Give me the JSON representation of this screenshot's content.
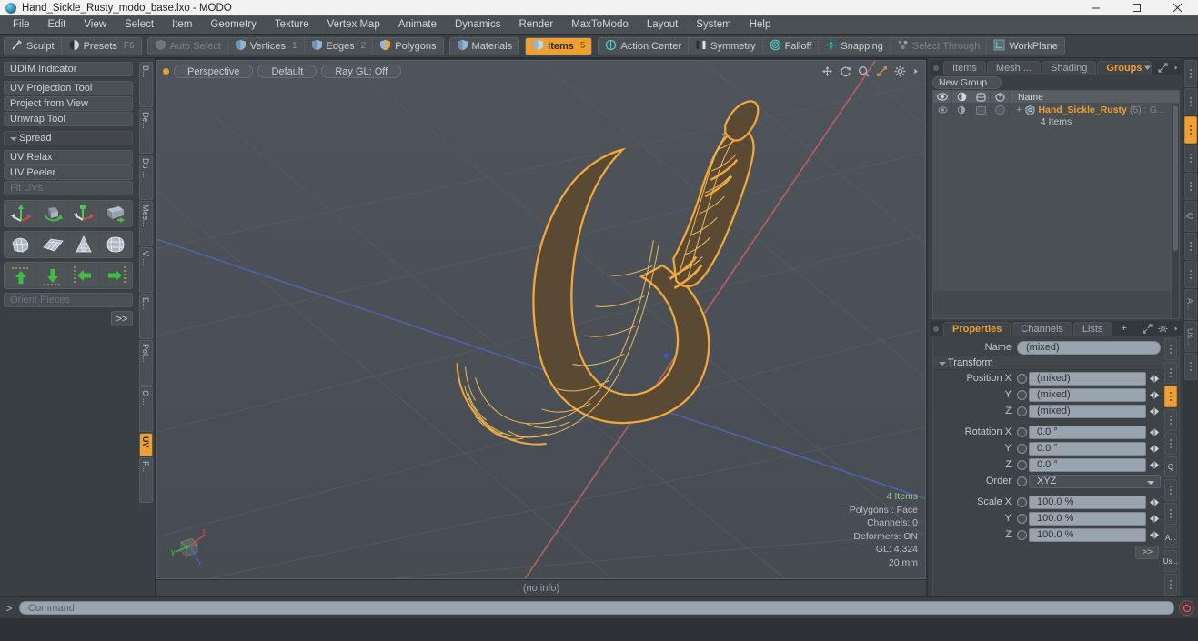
{
  "window": {
    "title": "Hand_Sickle_Rusty_modo_base.lxo - MODO",
    "app_icon": "modo-sphere-icon",
    "minimize": "—",
    "maximize": "☐",
    "close": "✕"
  },
  "menubar": {
    "items": [
      {
        "label": "File"
      },
      {
        "label": "Edit"
      },
      {
        "label": "View"
      },
      {
        "label": "Select"
      },
      {
        "label": "Item"
      },
      {
        "label": "Geometry"
      },
      {
        "label": "Texture"
      },
      {
        "label": "Vertex Map"
      },
      {
        "label": "Animate"
      },
      {
        "label": "Dynamics"
      },
      {
        "label": "Render"
      },
      {
        "label": "MaxToModo"
      },
      {
        "label": "Layout"
      },
      {
        "label": "System"
      },
      {
        "label": "Help"
      }
    ]
  },
  "toolbar": {
    "group1": [
      {
        "label": "Sculpt",
        "icon": "brush-icon",
        "num": "",
        "state": "normal"
      },
      {
        "label": "Presets",
        "icon": "sphere-icon",
        "num": "F6",
        "state": "normal"
      }
    ],
    "group2": [
      {
        "label": "Auto Select",
        "icon": "shield-grey-icon",
        "num": "",
        "state": "dim"
      },
      {
        "label": "Vertices",
        "icon": "shield-vertex-icon",
        "num": "1",
        "state": "normal"
      },
      {
        "label": "Edges",
        "icon": "shield-edge-icon",
        "num": "2",
        "state": "normal"
      },
      {
        "label": "Polygons",
        "icon": "shield-polygon-icon",
        "num": "",
        "state": "normal"
      }
    ],
    "group3": [
      {
        "label": "Materials",
        "icon": "shield-material-icon",
        "num": "",
        "state": "normal"
      }
    ],
    "group4": [
      {
        "label": "Items",
        "icon": "shield-items-icon",
        "num": "5",
        "state": "active"
      }
    ],
    "group5": [
      {
        "label": "Action Center",
        "icon": "target-icon",
        "num": "",
        "state": "normal"
      },
      {
        "label": "Symmetry",
        "icon": "symmetry-bars-icon",
        "num": "",
        "state": "normal"
      },
      {
        "label": "Falloff",
        "icon": "falloff-circle-icon",
        "num": "",
        "state": "normal"
      },
      {
        "label": "Snapping",
        "icon": "snap-cross-icon",
        "num": "",
        "state": "normal"
      },
      {
        "label": "Select Through",
        "icon": "select-through-icon",
        "num": "",
        "state": "dim"
      },
      {
        "label": "WorkPlane",
        "icon": "workplane-icon",
        "num": "",
        "state": "normal"
      }
    ]
  },
  "left_panel": {
    "rows_top": [
      {
        "label": "UDIM Indicator",
        "state": "normal"
      }
    ],
    "rows_mid": [
      {
        "label": "UV Projection Tool",
        "state": "normal"
      },
      {
        "label": "Project from View",
        "state": "normal"
      },
      {
        "label": "Unwrap Tool",
        "state": "normal"
      }
    ],
    "section_header": "Spread",
    "rows_bottom": [
      {
        "label": "UV Relax",
        "state": "normal"
      },
      {
        "label": "UV Peeler",
        "state": "normal"
      },
      {
        "label": "Fit UVs",
        "state": "dim"
      }
    ],
    "icon_grid_1": [
      "move-axis-icon",
      "rotate-cube-icon",
      "scale-axis-icon",
      "transform-box-icon"
    ],
    "icon_grid_2": [
      "shrink-mesh-icon",
      "grid-flat-icon",
      "cone-grid-icon",
      "sphere-grid-icon"
    ],
    "icon_grid_3": [
      "align-up-icon",
      "align-down-icon",
      "align-left-icon",
      "align-right-icon"
    ],
    "orient_field_placeholder": "Orient Pieces",
    "more_button": ">>",
    "vtabs": [
      {
        "label": "B...",
        "state": "normal"
      },
      {
        "label": "De...",
        "state": "normal"
      },
      {
        "label": "Du ...",
        "state": "normal"
      },
      {
        "label": "Mes...",
        "state": "normal"
      },
      {
        "label": "V ...",
        "state": "normal"
      },
      {
        "label": "E...",
        "state": "normal"
      },
      {
        "label": "Pol...",
        "state": "normal"
      },
      {
        "label": "C ...",
        "state": "normal"
      },
      {
        "label": "UV",
        "state": "active"
      },
      {
        "label": "F...",
        "state": "normal"
      }
    ]
  },
  "viewport": {
    "buttons": [
      {
        "label": "Perspective"
      },
      {
        "label": "Default"
      },
      {
        "label": "Ray GL: Off"
      }
    ],
    "tool_icons": [
      "pan-icon",
      "rotate-icon",
      "zoom-icon",
      "fit-icon",
      "gear-icon",
      "chevron-right-icon"
    ],
    "info": {
      "items": "4 Items",
      "polygons": "Polygons : Face",
      "channels": "Channels: 0",
      "deformers": "Deformers: ON",
      "gl": "GL: 4,324",
      "scale": "20 mm"
    },
    "axis_gizmo": [
      "x",
      "y",
      "z"
    ],
    "status": "(no info)",
    "model": "hand-sickle-rusty-wireframe",
    "colors": {
      "selection": "#f0a030",
      "background": "#4a5055",
      "axis_x": "#b55a5a",
      "axis_z": "#5a6fb5",
      "grid": "#565c62"
    }
  },
  "right_panel": {
    "tabs": [
      {
        "label": "Items",
        "state": "normal"
      },
      {
        "label": "Mesh ...",
        "state": "normal"
      },
      {
        "label": "Shading",
        "state": "normal"
      },
      {
        "label": "Groups",
        "state": "active"
      }
    ],
    "tab_icons": [
      "chevron-down-icon",
      "expand-icon",
      "chevron-right-icon"
    ],
    "new_group_button": "New Group",
    "list": {
      "col_icons": [
        "eye-icon",
        "render-icon",
        "wireframe-icon",
        "shaded-icon"
      ],
      "name_header": "Name",
      "rows": [
        {
          "icon": "group-shield-icon",
          "name": "Hand_Sickle_Rusty",
          "count": "(5)",
          "suffix": ": G...",
          "sub": "4 Items"
        }
      ]
    }
  },
  "properties": {
    "tabs": [
      {
        "label": "Properties",
        "state": "active"
      },
      {
        "label": "Channels",
        "state": "normal"
      },
      {
        "label": "Lists",
        "state": "normal"
      },
      {
        "label": "+",
        "state": "normal"
      }
    ],
    "tab_icons": [
      "expand-icon",
      "gear-icon",
      "chevron-right-icon"
    ],
    "name_label": "Name",
    "name_value": "(mixed)",
    "transform_header": "Transform",
    "fields": [
      {
        "label": "Position X",
        "value": "(mixed)",
        "type": "text"
      },
      {
        "label": "Y",
        "value": "(mixed)",
        "type": "text"
      },
      {
        "label": "Z",
        "value": "(mixed)",
        "type": "text"
      },
      {
        "label": "Rotation X",
        "value": "0.0 °",
        "type": "text"
      },
      {
        "label": "Y",
        "value": "0.0 °",
        "type": "text"
      },
      {
        "label": "Z",
        "value": "0.0 °",
        "type": "text"
      },
      {
        "label": "Order",
        "value": "XYZ",
        "type": "select"
      },
      {
        "label": "Scale X",
        "value": "100.0 %",
        "type": "text"
      },
      {
        "label": "Y",
        "value": "100.0 %",
        "type": "text"
      },
      {
        "label": "Z",
        "value": "100.0 %",
        "type": "text"
      }
    ],
    "more_button": ">>",
    "side_tabs": [
      {
        "label": "",
        "state": "normal"
      },
      {
        "label": "",
        "state": "normal"
      },
      {
        "label": "",
        "state": "active"
      },
      {
        "label": "",
        "state": "normal"
      },
      {
        "label": "",
        "state": "normal"
      },
      {
        "label": "Q",
        "state": "normal"
      },
      {
        "label": "",
        "state": "normal"
      },
      {
        "label": "",
        "state": "normal"
      },
      {
        "label": "A...",
        "state": "normal"
      },
      {
        "label": "Us...",
        "state": "normal"
      },
      {
        "label": "",
        "state": "normal"
      }
    ]
  },
  "command_bar": {
    "prompt": ">",
    "placeholder": "Command",
    "record_icon": "record-icon"
  }
}
